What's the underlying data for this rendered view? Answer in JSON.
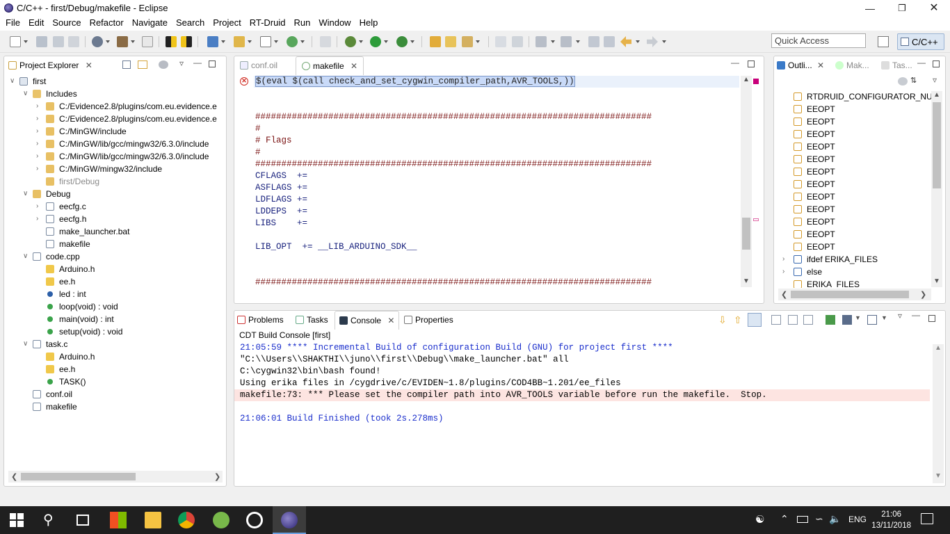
{
  "window": {
    "title": "C/C++ - first/Debug/makefile - Eclipse"
  },
  "menu": [
    "File",
    "Edit",
    "Source",
    "Refactor",
    "Navigate",
    "Search",
    "Project",
    "RT-Druid",
    "Run",
    "Window",
    "Help"
  ],
  "quick_access": {
    "placeholder": "Quick Access"
  },
  "perspective": {
    "label": "C/C++"
  },
  "project_explorer": {
    "tab": "Project Explorer",
    "tree": [
      {
        "label": "first",
        "depth": 0,
        "exp": "v",
        "icon": "project"
      },
      {
        "label": "Includes",
        "depth": 1,
        "exp": "v",
        "icon": "includes"
      },
      {
        "label": "C:/Evidence2.8/plugins/com.eu.evidence.e",
        "depth": 2,
        "exp": ">",
        "icon": "folder"
      },
      {
        "label": "C:/Evidence2.8/plugins/com.eu.evidence.e",
        "depth": 2,
        "exp": ">",
        "icon": "folder"
      },
      {
        "label": "C:/MinGW/include",
        "depth": 2,
        "exp": ">",
        "icon": "folder"
      },
      {
        "label": "C:/MinGW/lib/gcc/mingw32/6.3.0/include",
        "depth": 2,
        "exp": ">",
        "icon": "folder"
      },
      {
        "label": "C:/MinGW/lib/gcc/mingw32/6.3.0/include",
        "depth": 2,
        "exp": ">",
        "icon": "folder"
      },
      {
        "label": "C:/MinGW/mingw32/include",
        "depth": 2,
        "exp": ">",
        "icon": "folder"
      },
      {
        "label": "first/Debug",
        "depth": 2,
        "exp": "",
        "icon": "folder",
        "grey": true
      },
      {
        "label": "Debug",
        "depth": 1,
        "exp": "v",
        "icon": "folder"
      },
      {
        "label": "eecfg.c",
        "depth": 2,
        "exp": ">",
        "icon": "cfile"
      },
      {
        "label": "eecfg.h",
        "depth": 2,
        "exp": ">",
        "icon": "hfile"
      },
      {
        "label": "make_launcher.bat",
        "depth": 2,
        "exp": "",
        "icon": "file"
      },
      {
        "label": "makefile",
        "depth": 2,
        "exp": "",
        "icon": "makefile"
      },
      {
        "label": "code.cpp",
        "depth": 1,
        "exp": "v",
        "icon": "cfile"
      },
      {
        "label": "Arduino.h",
        "depth": 2,
        "exp": "",
        "icon": "include"
      },
      {
        "label": "ee.h",
        "depth": 2,
        "exp": "",
        "icon": "include"
      },
      {
        "label": "led : int",
        "depth": 2,
        "exp": "",
        "icon": "var"
      },
      {
        "label": "loop(void) : void",
        "depth": 2,
        "exp": "",
        "icon": "func"
      },
      {
        "label": "main(void) : int",
        "depth": 2,
        "exp": "",
        "icon": "func"
      },
      {
        "label": "setup(void) : void",
        "depth": 2,
        "exp": "",
        "icon": "func"
      },
      {
        "label": "task.c",
        "depth": 1,
        "exp": "v",
        "icon": "cfile"
      },
      {
        "label": "Arduino.h",
        "depth": 2,
        "exp": "",
        "icon": "include"
      },
      {
        "label": "ee.h",
        "depth": 2,
        "exp": "",
        "icon": "include"
      },
      {
        "label": "TASK()",
        "depth": 2,
        "exp": "",
        "icon": "func"
      },
      {
        "label": "conf.oil",
        "depth": 1,
        "exp": "",
        "icon": "file"
      },
      {
        "label": "makefile",
        "depth": 1,
        "exp": "",
        "icon": "makefile"
      }
    ]
  },
  "editor": {
    "tabs": [
      {
        "label": "conf.oil",
        "active": false
      },
      {
        "label": "makefile",
        "active": true
      }
    ],
    "lines": [
      {
        "text": "$(eval $(call check_and_set_cygwin_compiler_path,AVR_TOOLS,))",
        "style": "sel"
      },
      {
        "text": "",
        "style": ""
      },
      {
        "text": "",
        "style": ""
      },
      {
        "text": "############################################################################",
        "style": "hash"
      },
      {
        "text": "#",
        "style": "hash"
      },
      {
        "text": "# Flags",
        "style": "hash"
      },
      {
        "text": "#",
        "style": "hash"
      },
      {
        "text": "############################################################################",
        "style": "hash"
      },
      {
        "text": "CFLAGS  +=",
        "style": "kw"
      },
      {
        "text": "ASFLAGS +=",
        "style": "kw"
      },
      {
        "text": "LDFLAGS +=",
        "style": "kw"
      },
      {
        "text": "LDDEPS  +=",
        "style": "kw"
      },
      {
        "text": "LIBS    +=",
        "style": "kw"
      },
      {
        "text": "",
        "style": ""
      },
      {
        "text": "LIB_OPT  += __LIB_ARDUINO_SDK__",
        "style": "kw"
      },
      {
        "text": "",
        "style": ""
      },
      {
        "text": "",
        "style": ""
      },
      {
        "text": "############################################################################",
        "style": "hash"
      }
    ]
  },
  "outline": {
    "tabs": [
      "Outli...",
      "Mak...",
      "Tas..."
    ],
    "items": [
      {
        "label": "RTDRUID_CONFIGURATOR_NUME",
        "icon": "doc"
      },
      {
        "label": "EEOPT",
        "icon": "doc"
      },
      {
        "label": "EEOPT",
        "icon": "doc"
      },
      {
        "label": "EEOPT",
        "icon": "doc"
      },
      {
        "label": "EEOPT",
        "icon": "doc"
      },
      {
        "label": "EEOPT",
        "icon": "doc"
      },
      {
        "label": "EEOPT",
        "icon": "doc"
      },
      {
        "label": "EEOPT",
        "icon": "doc"
      },
      {
        "label": "EEOPT",
        "icon": "doc"
      },
      {
        "label": "EEOPT",
        "icon": "doc"
      },
      {
        "label": "EEOPT",
        "icon": "doc"
      },
      {
        "label": "EEOPT",
        "icon": "doc"
      },
      {
        "label": "EEOPT",
        "icon": "doc"
      },
      {
        "label": "ifdef ERIKA_FILES",
        "icon": "cond",
        "exp": true
      },
      {
        "label": "else",
        "icon": "cond",
        "exp": true
      },
      {
        "label": "ERIKA_FILES",
        "icon": "doc"
      }
    ]
  },
  "bottom": {
    "tabs": [
      "Problems",
      "Tasks",
      "Console",
      "Properties"
    ],
    "active": "Console",
    "console_title": "CDT Build Console [first]",
    "lines": [
      {
        "text": "21:05:59 **** Incremental Build of configuration Build (GNU) for project first ****",
        "style": "blue"
      },
      {
        "text": "\"C:\\\\Users\\\\SHAKTHI\\\\juno\\\\first\\\\Debug\\\\make_launcher.bat\" all",
        "style": ""
      },
      {
        "text": "C:\\cygwin32\\bin\\bash found!",
        "style": ""
      },
      {
        "text": "Using erika files in /cygdrive/c/EVIDEN~1.8/plugins/COD4BB~1.201/ee_files",
        "style": ""
      },
      {
        "text": "makefile:73: *** Please set the compiler path into AVR_TOOLS variable before run the makefile.  Stop.",
        "style": "err"
      },
      {
        "text": "",
        "style": ""
      },
      {
        "text": "21:06:01 Build Finished (took 2s.278ms)",
        "style": "blue"
      }
    ]
  },
  "taskbar": {
    "lang": "ENG",
    "time": "21:06",
    "date": "13/11/2018"
  },
  "colors": {
    "selection": "#c9daf8",
    "error_line": "#fde4e1",
    "console_blue": "#1a2ecc",
    "hash": "#7a1212"
  }
}
